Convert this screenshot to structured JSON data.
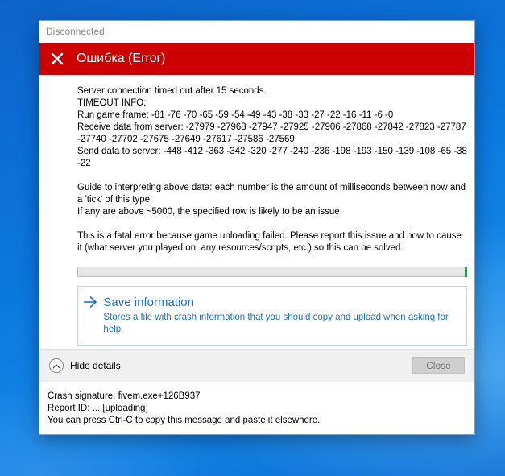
{
  "window": {
    "title": "Disconnected"
  },
  "header": {
    "title": "Ошибка (Error)",
    "icon": "error-x-icon",
    "color": "#cc0000"
  },
  "message": {
    "line1": "Server connection timed out after 15 seconds.",
    "line2": "TIMEOUT INFO:",
    "run_frame": "Run game frame: -81 -76 -70 -65 -59 -54 -49 -43 -38 -33 -27 -22 -16 -11 -6 -0",
    "receive_data": "Receive data from server: -27979 -27968 -27947 -27925 -27906 -27868 -27842 -27823 -27787 -27740 -27702 -27675 -27649 -27617 -27586 -27569",
    "send_data": "Send data to server: -448 -412 -363 -342 -320 -277 -240 -236 -198 -193 -150 -139 -108 -65 -38 -22",
    "guide": "Guide to interpreting above data: each number is the amount of milliseconds between now and a 'tick' of this type.",
    "guide2": "If any are above ~5000, the specified row is likely to be an issue.",
    "fatal": "This is a fatal error because game unloading failed. Please report this issue and how to cause it (what server you played on, any resources/scripts, etc.) so this can be solved."
  },
  "progress": {
    "value": 1.0,
    "color": "#06b025"
  },
  "save": {
    "icon": "arrow-right-icon",
    "title": "Save information",
    "description": "Stores a file with crash information that you should copy and upload when asking for help."
  },
  "footer": {
    "toggle_icon": "chevron-up-icon",
    "toggle_label": "Hide details",
    "close_label": "Close"
  },
  "details": {
    "signature": "Crash signature: fivem.exe+126B937",
    "report_id": "Report ID: ... [uploading]",
    "hint": "You can press Ctrl-C to copy this message and paste it elsewhere."
  }
}
